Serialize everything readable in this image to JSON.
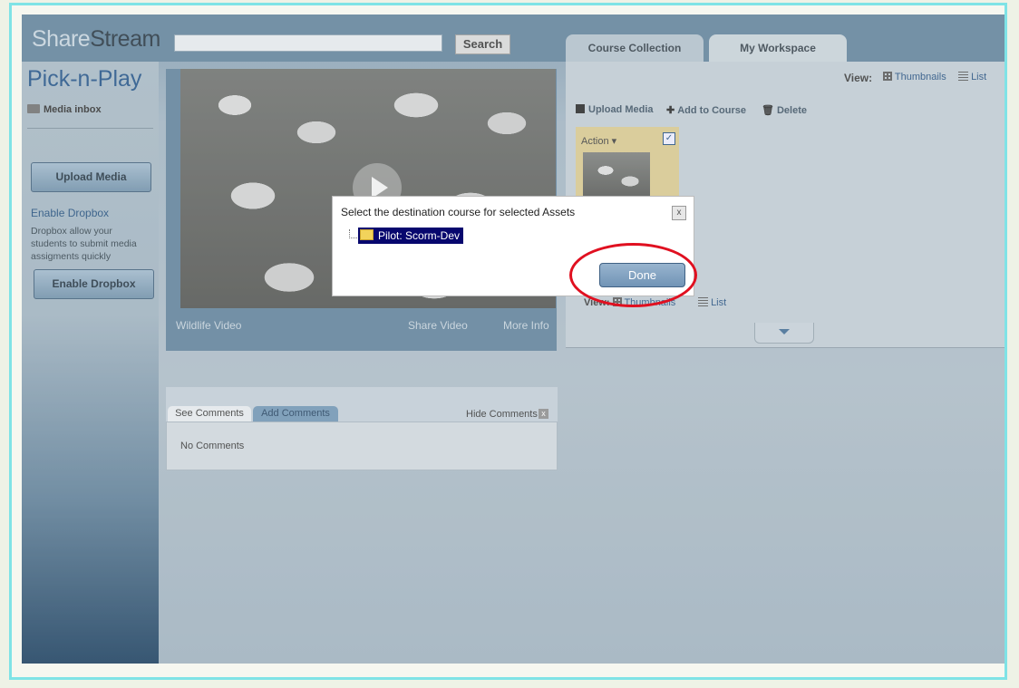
{
  "header": {
    "logo_part1": "Share",
    "logo_part2": "Stream",
    "search_value": "",
    "search_button": "Search",
    "tabs": [
      {
        "label": "Course Collection"
      },
      {
        "label": "My Workspace"
      }
    ]
  },
  "sidebar": {
    "title": "Pick-n-Play",
    "media_inbox": "Media inbox",
    "upload_button": "Upload Media",
    "enable_dropbox_link": "Enable Dropbox",
    "dropbox_description": "Dropbox allow your students to submit media assigments quickly",
    "enable_dropbox_button": "Enable Dropbox"
  },
  "video": {
    "title": "Wildlife Video",
    "share": "Share Video",
    "more": "More Info"
  },
  "comments": {
    "tab_see": "See Comments",
    "tab_add": "Add Comments",
    "hide": "Hide Comments",
    "hide_icon": "x",
    "empty": "No Comments"
  },
  "workspace": {
    "view_label": "View:",
    "thumbnails": "Thumbnails",
    "list": "List",
    "actions": {
      "upload": "Upload Media",
      "add": "Add to Course",
      "delete": "Delete"
    },
    "card": {
      "action": "Action",
      "checked": "✓"
    },
    "bottom_view_label": "View:",
    "bottom_thumbnails": "Thumbnails",
    "bottom_list": "List"
  },
  "dialog": {
    "title": "Select the destination course for selected Assets",
    "close": "x",
    "tree_item": "Pilot: Scorm-Dev",
    "done": "Done"
  },
  "colors": {
    "accent_highlight": "#e01020",
    "link": "#1f4c7e"
  }
}
